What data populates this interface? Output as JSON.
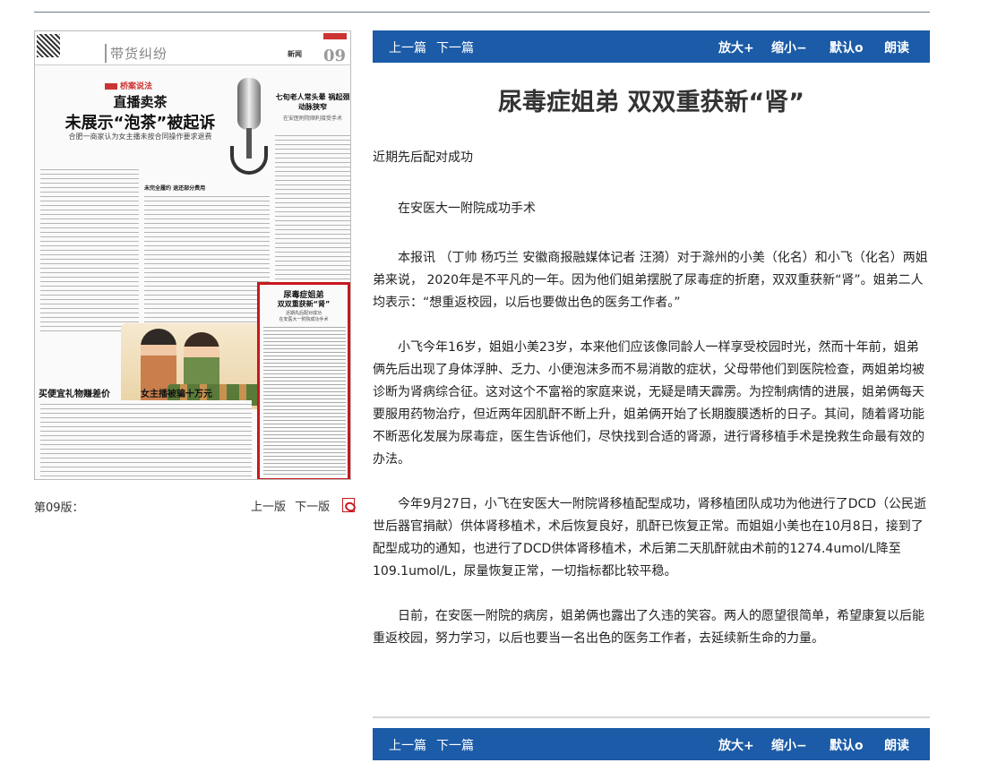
{
  "newspaper": {
    "column_name": "带货纠纷",
    "section": "新闻",
    "page_number": "09",
    "law_tag": "桥案说法",
    "headline_line1": "直播卖茶",
    "headline_line2": "未展示“泡茶”被起诉",
    "headline_sub": "合肥一商家认为女主播未按合同操作要求退费",
    "mid_subhead": "未完全履约 退还部分费用",
    "side_headline": "七旬老人常头晕 祸起颈动脉狭窄",
    "side_subline": "在安医附院顺利接受手术",
    "feature_title_line1": "尿毒症姐弟",
    "feature_title_line2": "双双重获新“肾”",
    "feature_sub1": "近期先后配对成功",
    "feature_sub2": "在安医大一附院成功手术",
    "bottom_headline1": "买便宜礼物赚差价",
    "bottom_headline2": "女主播被骗十万元"
  },
  "page_footer": {
    "label": "第09版：",
    "prev": "上一版",
    "next": "下一版",
    "pdf_icon": "pdf-icon"
  },
  "toolbar": {
    "prev": "上一篇",
    "next": "下一篇",
    "zoom_in": "放大+",
    "zoom_out": "缩小−",
    "reset": "默认o",
    "read": "朗读"
  },
  "article": {
    "title": "尿毒症姐弟 双双重获新“肾”",
    "subtitle1": "近期先后配对成功",
    "subtitle2": "在安医大一附院成功手术",
    "paragraphs": [
      "本报讯 （丁帅 杨巧兰 安徽商报融媒体记者 汪漪）对于滁州的小美（化名）和小飞（化名）两姐弟来说， 2020年是不平凡的一年。因为他们姐弟摆脱了尿毒症的折磨，双双重获新“肾”。姐弟二人均表示：“想重返校园，以后也要做出色的医务工作者。”",
      "小飞今年16岁，姐姐小美23岁，本来他们应该像同龄人一样享受校园时光，然而十年前，姐弟俩先后出现了身体浮肿、乏力、小便泡沫多而不易消散的症状，父母带他们到医院检查，两姐弟均被诊断为肾病综合征。这对这个不富裕的家庭来说，无疑是晴天霹雳。为控制病情的进展，姐弟俩每天要服用药物治疗，但近两年因肌酐不断上升，姐弟俩开始了长期腹膜透析的日子。其间，随着肾功能不断恶化发展为尿毒症，医生告诉他们，尽快找到合适的肾源，进行肾移植手术是挽救生命最有效的办法。",
      "今年9月27日，小飞在安医大一附院肾移植配型成功，肾移植团队成功为他进行了DCD（公民逝世后器官捐献）供体肾移植术，术后恢复良好，肌酐已恢复正常。而姐姐小美也在10月8日，接到了配型成功的通知，也进行了DCD供体肾移植术，术后第二天肌酐就由术前的1274.4umol/L降至109.1umol/L，尿量恢复正常，一切指标都比较平稳。",
      "日前，在安医一附院的病房，姐弟俩也露出了久违的笑容。两人的愿望很简单，希望康复以后能重返校园，努力学习，以后也要当一名出色的医务工作者，去延续新生命的力量。"
    ]
  },
  "colors": {
    "toolbar_bg": "#1b5ba7",
    "highlight_box": "#c8181e"
  }
}
